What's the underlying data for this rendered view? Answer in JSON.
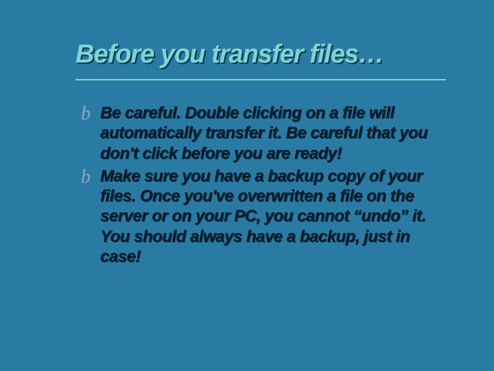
{
  "title": "Before you transfer files…",
  "bullets": [
    "Be careful.  Double clicking on a file will automatically transfer it.  Be careful that you don't click before you are ready!",
    "Make sure you have a backup copy of your files.  Once you've overwritten a file on the server or on your PC, you cannot “undo” it.  You should always have a backup, just in case!"
  ],
  "bullet_glyph": "b"
}
